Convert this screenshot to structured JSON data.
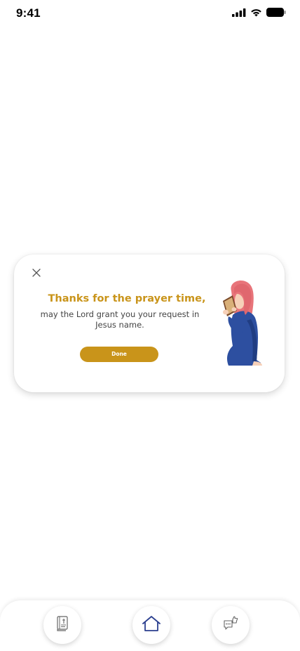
{
  "status_bar": {
    "time": "9:41",
    "icons": [
      "signal-icon",
      "wifi-icon",
      "battery-icon"
    ]
  },
  "modal": {
    "title": "Thanks for the prayer time,",
    "message": "may the Lord grant you your request in Jesus name.",
    "done_label": "Done",
    "close_icon": "close-icon",
    "illustration": "praying-woman-illustration"
  },
  "bottom_nav": {
    "items": [
      {
        "icon": "bible-icon"
      },
      {
        "icon": "home-icon",
        "active": true
      },
      {
        "icon": "testimony-icon"
      }
    ]
  },
  "colors": {
    "accent": "#c9941a",
    "nav_active": "#2b3f8f",
    "text_muted": "#444444"
  }
}
